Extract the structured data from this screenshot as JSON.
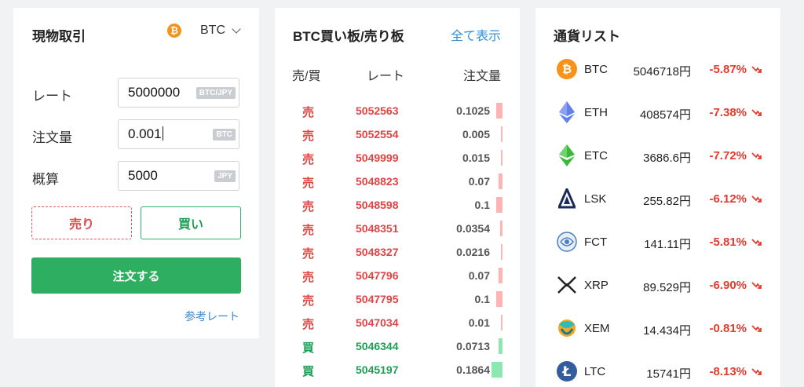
{
  "trade": {
    "title": "現物取引",
    "coin_icon_glyph": "₿",
    "coin_select": "BTC",
    "rate_label": "レート",
    "rate_value": "5000000",
    "rate_unit": "BTC/JPY",
    "amount_label": "注文量",
    "amount_value": "0.001",
    "amount_unit": "BTC",
    "estimate_label": "概算",
    "estimate_value": "5000",
    "estimate_unit": "JPY",
    "sell_label": "売り",
    "buy_label": "買い",
    "order_label": "注文する",
    "ref_rate_link": "参考レート"
  },
  "order_book": {
    "title": "BTC買い板/売り板",
    "show_all": "全て表示",
    "col_side": "売/買",
    "col_rate": "レート",
    "col_amount": "注文量",
    "rows": [
      {
        "side": "売",
        "type": "sell",
        "rate": "5052563",
        "amount": "0.1025"
      },
      {
        "side": "売",
        "type": "sell",
        "rate": "5052554",
        "amount": "0.005"
      },
      {
        "side": "売",
        "type": "sell",
        "rate": "5049999",
        "amount": "0.015"
      },
      {
        "side": "売",
        "type": "sell",
        "rate": "5048823",
        "amount": "0.07"
      },
      {
        "side": "売",
        "type": "sell",
        "rate": "5048598",
        "amount": "0.1"
      },
      {
        "side": "売",
        "type": "sell",
        "rate": "5048351",
        "amount": "0.0354"
      },
      {
        "side": "売",
        "type": "sell",
        "rate": "5048327",
        "amount": "0.0216"
      },
      {
        "side": "売",
        "type": "sell",
        "rate": "5047796",
        "amount": "0.07"
      },
      {
        "side": "売",
        "type": "sell",
        "rate": "5047795",
        "amount": "0.1"
      },
      {
        "side": "売",
        "type": "sell",
        "rate": "5047034",
        "amount": "0.01"
      },
      {
        "side": "買",
        "type": "buy",
        "rate": "5046344",
        "amount": "0.0713"
      },
      {
        "side": "買",
        "type": "buy",
        "rate": "5045197",
        "amount": "0.1864"
      }
    ]
  },
  "currency_list": {
    "title": "通貨リスト",
    "coins": [
      {
        "symbol": "BTC",
        "price": "5046718円",
        "change": "-5.87%",
        "icon": "btc-icon",
        "color": "#f7931a"
      },
      {
        "symbol": "ETH",
        "price": "408574円",
        "change": "-7.38%",
        "icon": "eth-icon",
        "color": "#627eea"
      },
      {
        "symbol": "ETC",
        "price": "3686.6円",
        "change": "-7.72%",
        "icon": "etc-icon",
        "color": "#3ab83a"
      },
      {
        "symbol": "LSK",
        "price": "255.82円",
        "change": "-6.12%",
        "icon": "lsk-icon",
        "color": "#1a2a5a"
      },
      {
        "symbol": "FCT",
        "price": "141.11円",
        "change": "-5.81%",
        "icon": "fct-icon",
        "color": "#4a7fc0"
      },
      {
        "symbol": "XRP",
        "price": "89.529円",
        "change": "-6.90%",
        "icon": "xrp-icon",
        "color": "#222222"
      },
      {
        "symbol": "XEM",
        "price": "14.434円",
        "change": "-0.81%",
        "icon": "xem-icon",
        "color": "#2dbdb6"
      },
      {
        "symbol": "LTC",
        "price": "15741円",
        "change": "-8.13%",
        "icon": "ltc-icon",
        "color": "#345d9d"
      }
    ]
  },
  "colors": {
    "sell": "#e24444",
    "buy": "#1f9e57",
    "order_button": "#2eae61",
    "link": "#2f8fd8",
    "negative_change": "#e53a2f"
  }
}
